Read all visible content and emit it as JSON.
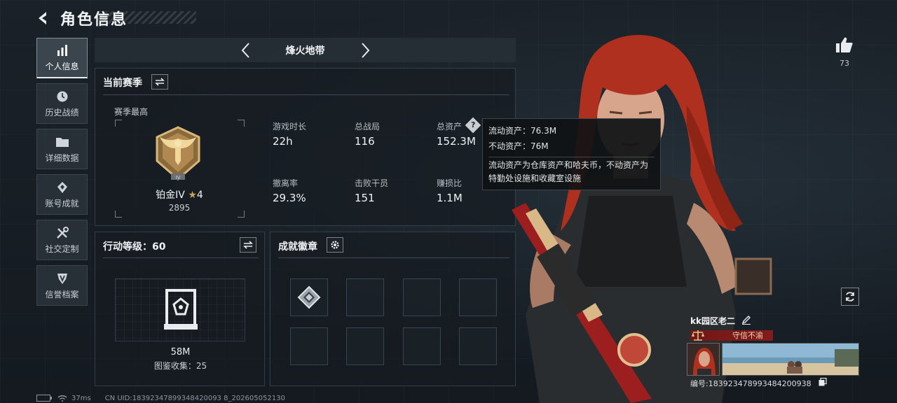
{
  "header": {
    "title": "角色信息"
  },
  "sidebar": {
    "items": [
      {
        "label": "个人信息",
        "icon": "bar-chart-icon",
        "active": true
      },
      {
        "label": "历史战绩",
        "icon": "clock-icon"
      },
      {
        "label": "详细数据",
        "icon": "folder-icon"
      },
      {
        "label": "账号成就",
        "icon": "achievement-icon"
      },
      {
        "label": "社交定制",
        "icon": "tools-icon"
      },
      {
        "label": "信誉档案",
        "icon": "shield-icon"
      }
    ]
  },
  "mode": {
    "name": "烽火地带"
  },
  "season": {
    "title": "当前赛季",
    "best_label": "赛季最高",
    "rank_name": "铂金IV",
    "rank_stars": "4",
    "rank_score": "2895",
    "stats": [
      {
        "label": "游戏时长",
        "value": "22h"
      },
      {
        "label": "总战局",
        "value": "116"
      },
      {
        "label": "总资产",
        "value": "152.3M"
      },
      {
        "label": "撤离率",
        "value": "29.3%"
      },
      {
        "label": "击败干员",
        "value": "151"
      },
      {
        "label": "赚损比",
        "value": "1.1M"
      }
    ]
  },
  "tooltip": {
    "liquid": "流动资产：76.3M",
    "fixed": "不动资产：76M",
    "description": "流动资产为仓库资产和哈夫币，不动资产为特勤处设施和收藏室设施"
  },
  "action_level": {
    "title": "行动等级：60",
    "value": "58M",
    "collection": "图鉴收集：25"
  },
  "achievements": {
    "title": "成就徽章"
  },
  "likes": {
    "count": "73"
  },
  "player": {
    "name": "kk园区老二",
    "reputation": "守信不渝",
    "id": "编号:1839234789934842009​38"
  },
  "status_bar": {
    "ping": "37ms",
    "uid": "CN UID:18392347899348420093 8_202605052130"
  },
  "colors": {
    "accent_red": "#9a1e1e",
    "rank_gold": "#c9a35a"
  }
}
